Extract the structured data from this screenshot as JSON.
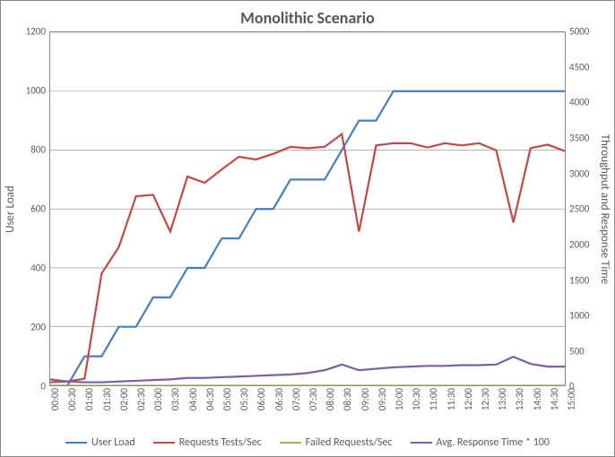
{
  "chart_data": {
    "type": "line",
    "title": "Monolithic Scenario",
    "xlabel": "",
    "ylabel": "User Load",
    "y2label": "Throughput and Response Time",
    "ylim": [
      0,
      1200
    ],
    "y2lim": [
      0,
      5000
    ],
    "yticks": [
      0,
      200,
      400,
      600,
      800,
      1000,
      1200
    ],
    "y2ticks": [
      0,
      500,
      1000,
      1500,
      2000,
      2500,
      3000,
      3500,
      4000,
      4500,
      5000
    ],
    "x": [
      "00:00",
      "00:30",
      "01:00",
      "01:30",
      "02:00",
      "02:30",
      "03:00",
      "03:30",
      "04:00",
      "04:30",
      "05:00",
      "05:30",
      "06:00",
      "06:30",
      "07:00",
      "07:30",
      "08:00",
      "08:30",
      "09:00",
      "09:30",
      "10:00",
      "10:30",
      "11:00",
      "11:30",
      "12:00",
      "12:30",
      "13:00",
      "13:30",
      "14:00",
      "14:30",
      "15:00"
    ],
    "series": [
      {
        "name": "User Load",
        "axis": "left",
        "color": "#4a7ebb",
        "values": [
          0,
          0,
          100,
          100,
          200,
          200,
          300,
          300,
          400,
          400,
          500,
          500,
          600,
          600,
          700,
          700,
          700,
          800,
          900,
          900,
          1000,
          1000,
          1000,
          1000,
          1000,
          1000,
          1000,
          1000,
          1000,
          1000,
          1000
        ]
      },
      {
        "name": "Requests Tests/Sec",
        "axis": "right",
        "color": "#be4b48",
        "values": [
          50,
          60,
          100,
          1590,
          1960,
          2680,
          2700,
          2180,
          2960,
          2870,
          3060,
          3240,
          3200,
          3280,
          3380,
          3360,
          3380,
          3560,
          2180,
          3400,
          3430,
          3430,
          3370,
          3430,
          3400,
          3430,
          3330,
          2310,
          3360,
          3410,
          3320
        ]
      },
      {
        "name": "Failed Requests/Sec",
        "axis": "right",
        "color": "#98b954",
        "values": [
          0,
          0,
          0,
          0,
          0,
          0,
          0,
          0,
          0,
          0,
          0,
          0,
          0,
          0,
          0,
          0,
          0,
          0,
          0,
          0,
          0,
          0,
          0,
          0,
          0,
          0,
          0,
          0,
          0,
          0,
          0
        ]
      },
      {
        "name": "Avg. Response Time * 100",
        "axis": "right",
        "color": "#7d60a0",
        "values": [
          90,
          60,
          50,
          50,
          60,
          70,
          80,
          90,
          110,
          110,
          120,
          130,
          140,
          150,
          160,
          180,
          220,
          300,
          220,
          240,
          260,
          270,
          280,
          280,
          290,
          290,
          300,
          410,
          310,
          270,
          270
        ]
      }
    ],
    "legend_position": "bottom"
  }
}
